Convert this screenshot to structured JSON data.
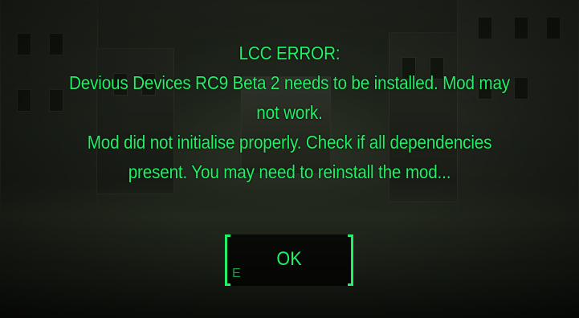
{
  "dialog": {
    "lines": [
      "LCC ERROR:",
      "Devious Devices RC9 Beta 2 needs to be installed. Mod may",
      "not work.",
      "Mod did not initialise properly. Check if all dependencies",
      "present. You may need to reinstall the mod..."
    ],
    "ok_label": "OK",
    "ok_hotkey": "E"
  },
  "colors": {
    "text": "#22f066",
    "button_bg": "#000000"
  }
}
